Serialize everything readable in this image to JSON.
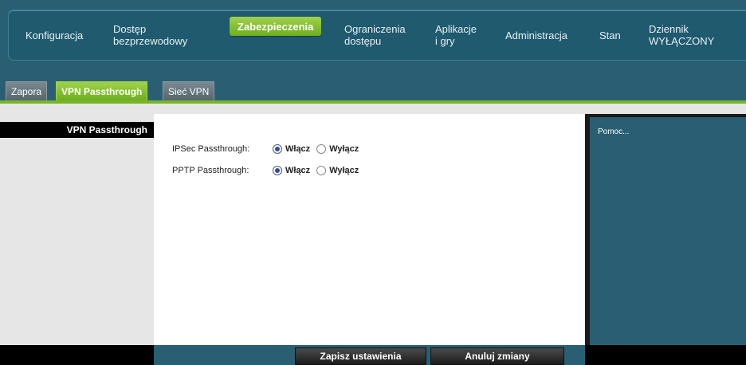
{
  "topnav": {
    "items": [
      {
        "lines": [
          "Konfiguracja"
        ]
      },
      {
        "lines": [
          "Dostęp",
          "bezprzewodowy"
        ]
      },
      {
        "lines": [
          "Zabezpieczenia"
        ],
        "active": true
      },
      {
        "lines": [
          "Ograniczenia",
          "dostępu"
        ]
      },
      {
        "lines": [
          "Aplikacje",
          "i gry"
        ]
      },
      {
        "lines": [
          "Administracja"
        ]
      },
      {
        "lines": [
          "Stan"
        ]
      },
      {
        "lines": [
          "Dziennik",
          "WYŁĄCZONY"
        ]
      }
    ]
  },
  "tabs": [
    {
      "label": "Zapora"
    },
    {
      "label": "VPN Passthrough",
      "active": true
    },
    {
      "label": "Sieć VPN"
    }
  ],
  "section": {
    "title": "VPN Passthrough"
  },
  "settings": [
    {
      "label": "IPSec Passthrough:",
      "options": [
        "Włącz",
        "Wyłącz"
      ],
      "selected": "Włącz"
    },
    {
      "label": "PPTP Passthrough:",
      "options": [
        "Włącz",
        "Wyłącz"
      ],
      "selected": "Włącz"
    }
  ],
  "help": {
    "title": "Pomoc..."
  },
  "footer": {
    "save_label": "Zapisz ustawienia",
    "cancel_label": "Anuluj zmiany"
  },
  "colors": {
    "accent_green": "#77b52a",
    "teal_bg": "#2a5f73"
  }
}
